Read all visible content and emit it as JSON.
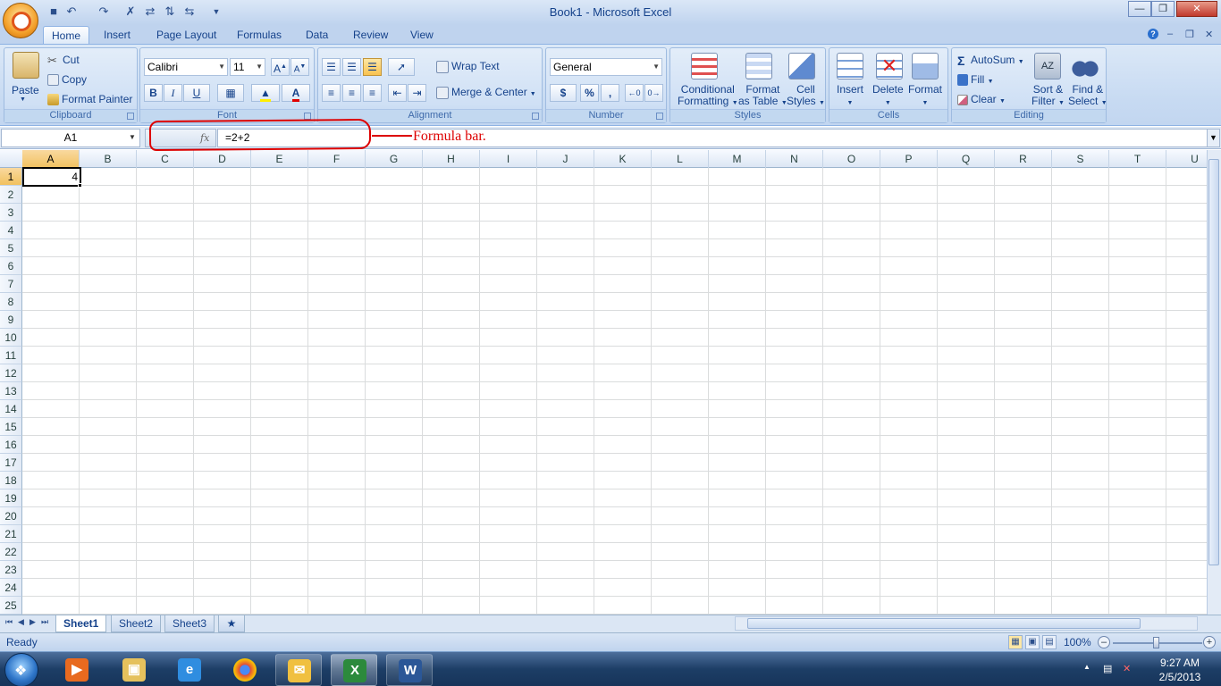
{
  "window": {
    "title": "Book1 - Microsoft Excel"
  },
  "tabs": [
    "Home",
    "Insert",
    "Page Layout",
    "Formulas",
    "Data",
    "Review",
    "View"
  ],
  "ribbon": {
    "clipboard": {
      "paste": "Paste",
      "cut": "Cut",
      "copy": "Copy",
      "format_painter": "Format Painter",
      "label": "Clipboard"
    },
    "font": {
      "family": "Calibri",
      "size": "11",
      "bold": "B",
      "italic": "I",
      "underline": "U",
      "label": "Font"
    },
    "alignment": {
      "wrap_text": "Wrap Text",
      "merge_center": "Merge & Center",
      "label": "Alignment"
    },
    "number": {
      "format": "General",
      "currency": "$",
      "percent": "%",
      "comma": ",",
      "label": "Number"
    },
    "styles": {
      "conditional_1": "Conditional",
      "conditional_2": "Formatting",
      "format_table_1": "Format",
      "format_table_2": "as Table",
      "cell_styles_1": "Cell",
      "cell_styles_2": "Styles",
      "label": "Styles"
    },
    "cells": {
      "insert": "Insert",
      "delete": "Delete",
      "format": "Format",
      "label": "Cells"
    },
    "editing": {
      "autosum": "AutoSum",
      "fill": "Fill",
      "clear": "Clear",
      "sort_1": "Sort &",
      "sort_2": "Filter",
      "find_1": "Find &",
      "find_2": "Select",
      "label": "Editing"
    }
  },
  "formula_bar": {
    "name_box": "A1",
    "fx": "fx",
    "formula": "=2+2"
  },
  "annotation": {
    "text": "Formula bar."
  },
  "columns": [
    "A",
    "B",
    "C",
    "D",
    "E",
    "F",
    "G",
    "H",
    "I",
    "J",
    "K",
    "L",
    "M",
    "N",
    "O",
    "P",
    "Q",
    "R",
    "S",
    "T",
    "U"
  ],
  "rows": [
    "1",
    "2",
    "3",
    "4",
    "5",
    "6",
    "7",
    "8",
    "9",
    "10",
    "11",
    "12",
    "13",
    "14",
    "15",
    "16",
    "17",
    "18",
    "19",
    "20",
    "21",
    "22",
    "23",
    "24",
    "25"
  ],
  "cells": {
    "A1": "4"
  },
  "sheets": [
    "Sheet1",
    "Sheet2",
    "Sheet3"
  ],
  "status": {
    "text": "Ready",
    "zoom": "100%"
  },
  "taskbar": {
    "time": "9:27 AM",
    "date": "2/5/2013"
  }
}
